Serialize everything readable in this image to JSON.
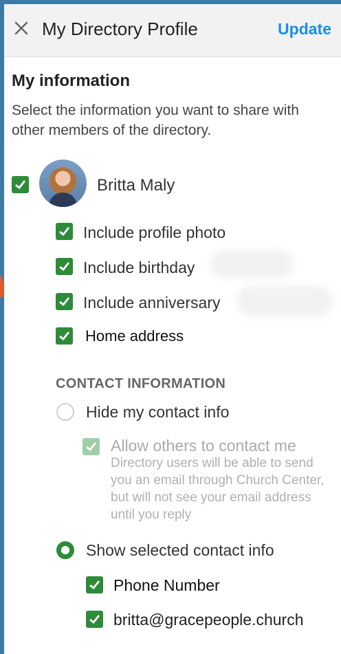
{
  "header": {
    "title": "My Directory Profile",
    "update_label": "Update"
  },
  "info": {
    "heading": "My information",
    "description": "Select the information you want to share with other members of the directory."
  },
  "profile": {
    "name": "Britta Maly",
    "options": [
      {
        "label": "Include profile photo",
        "checked": true
      },
      {
        "label": "Include birthday",
        "checked": true
      },
      {
        "label": "Include anniversary",
        "checked": true
      },
      {
        "label": "Home address",
        "checked": true
      }
    ]
  },
  "contact": {
    "section_title": "CONTACT INFORMATION",
    "hide_label": "Hide my contact info",
    "allow_label": "Allow others to contact me",
    "allow_description": "Directory users will be able to send you an email through Church Center, but will not see your email address until you reply",
    "show_label": "Show selected contact info",
    "items": [
      {
        "label": "Phone Number",
        "checked": true
      },
      {
        "label": "britta@gracepeople.church",
        "checked": true
      }
    ]
  },
  "colors": {
    "accent": "#2e8b3a",
    "link": "#1a8fe3"
  }
}
